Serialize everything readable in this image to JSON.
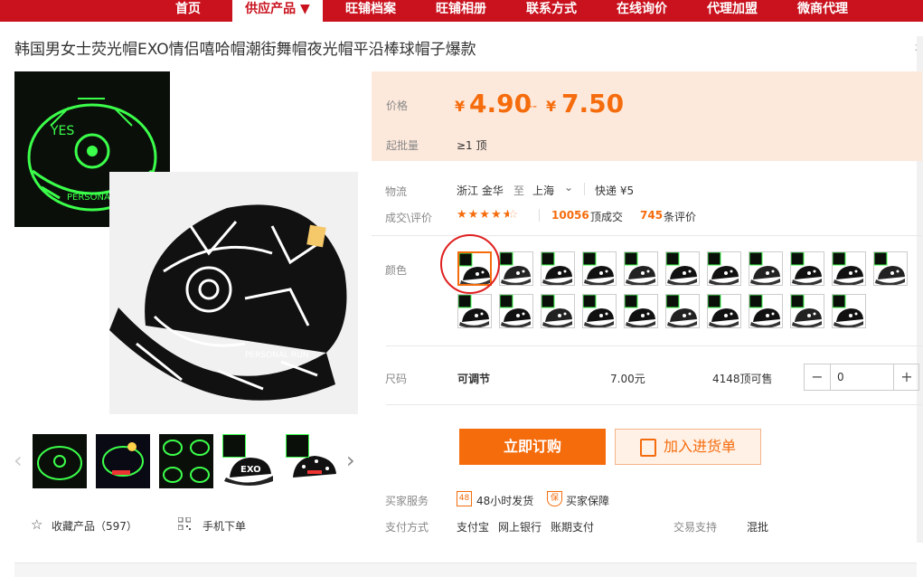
{
  "nav": {
    "items": [
      "首页",
      "供应产品 ▼",
      "旺铺档案",
      "旺铺相册",
      "联系方式",
      "在线询价",
      "代理加盟",
      "微商代理"
    ]
  },
  "title": "韩国男女士荧光帽EXO情侣嘻哈帽潮街舞帽夜光帽平沿棒球帽子爆款",
  "title_right": "本",
  "price": {
    "label": "价格",
    "low_sym": "¥",
    "low": "4.90",
    "sep": "--",
    "high_sym": "¥",
    "high": "7.50",
    "moq_label": "起批量",
    "moq_value": "≥1 顶"
  },
  "logistics": {
    "label": "物流",
    "origin": "浙江 金华",
    "to": "至",
    "dest": "上海",
    "express": "快递 ¥5"
  },
  "deals": {
    "label": "成交\\评价",
    "rating": 4.5,
    "count": "10056",
    "count_unit": "顶成交",
    "reviews": "745",
    "reviews_unit": "条评价"
  },
  "color": {
    "label": "颜色",
    "swatches": [
      "1",
      "2",
      "3",
      "4",
      "5",
      "6",
      "7",
      "8",
      "9",
      "10",
      "11",
      "12",
      "13",
      "14",
      "15",
      "16",
      "17",
      "18",
      "19",
      "20",
      "21"
    ]
  },
  "size": {
    "label": "尺码",
    "value": "可调节",
    "price": "7.00元",
    "stock": "4148顶可售",
    "qty": "0",
    "minus": "−",
    "plus": "+"
  },
  "actions": {
    "buy": "立即订购",
    "cart": "加入进货单"
  },
  "service": {
    "label": "买家服务",
    "items": [
      "48小时发货",
      "买家保障"
    ]
  },
  "payment": {
    "label": "支付方式",
    "items": [
      "支付宝",
      "网上银行",
      "账期支付"
    ],
    "trade_label": "交易支持",
    "trade_value": "混批"
  },
  "gallery": {
    "fav": "收藏产品（597）",
    "mobile": "手机下单",
    "thumb_text": "EXO"
  },
  "colors": {
    "brand_red": "#c9121e",
    "accent_orange": "#f56c0d",
    "glow": "#3bff4a"
  }
}
